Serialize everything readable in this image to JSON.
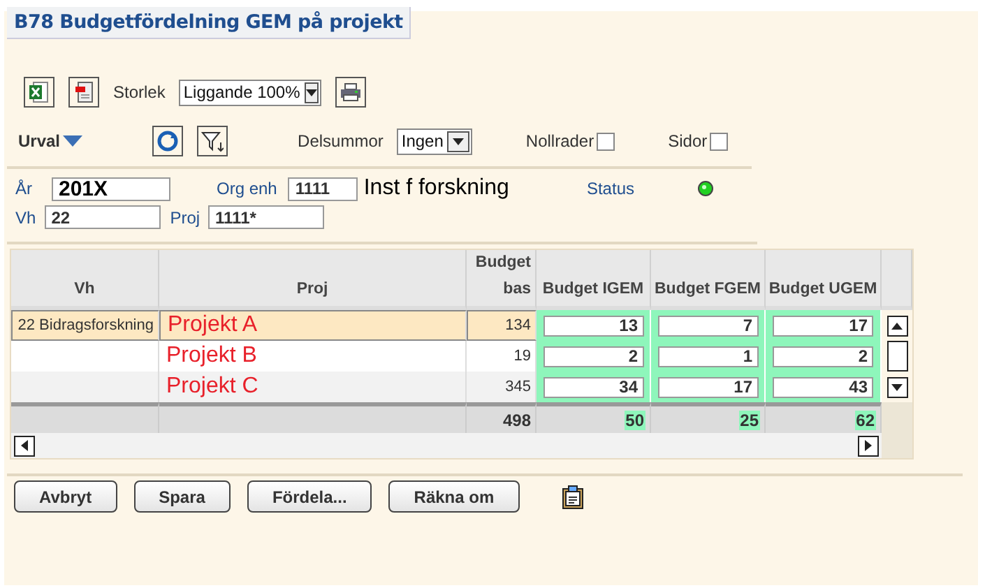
{
  "title": "B78 Budgetfördelning GEM på projekt",
  "toolbar": {
    "size_label": "Storlek",
    "size_value": "Liggande 100%"
  },
  "filter_bar": {
    "urval": "Urval",
    "subtotal_label": "Delsummor",
    "subtotal_value": "Ingen",
    "checkboxes": [
      {
        "label": "Nollrader",
        "checked": false
      },
      {
        "label": "Sidor",
        "checked": false
      }
    ]
  },
  "form": {
    "year_label": "År",
    "year": "201X",
    "org_label": "Org enh",
    "org": "1111",
    "org_name": "Inst f forskning",
    "status_label": "Status",
    "status_ok": true,
    "vh_label": "Vh",
    "vh": "22",
    "proj_label": "Proj",
    "proj": "1111*"
  },
  "table": {
    "columns": [
      "Vh",
      "Proj",
      "Budget bas",
      "Budget IGEM",
      "Budget FGEM",
      "Budget UGEM"
    ],
    "rows": [
      {
        "vh": "22 Bidragsforskning",
        "proj": "Projekt A",
        "bas": "134",
        "igem": "13",
        "fgem": "7",
        "ugem": "17",
        "selected": true
      },
      {
        "vh": "",
        "proj": "Projekt B",
        "bas": "19",
        "igem": "2",
        "fgem": "1",
        "ugem": "2",
        "selected": false
      },
      {
        "vh": "",
        "proj": "Projekt C",
        "bas": "345",
        "igem": "34",
        "fgem": "17",
        "ugem": "43",
        "selected": false
      }
    ],
    "totals": {
      "bas": "498",
      "igem": "50",
      "fgem": "25",
      "ugem": "62"
    }
  },
  "buttons": [
    "Avbryt",
    "Spara",
    "Fördela...",
    "Räkna om"
  ]
}
